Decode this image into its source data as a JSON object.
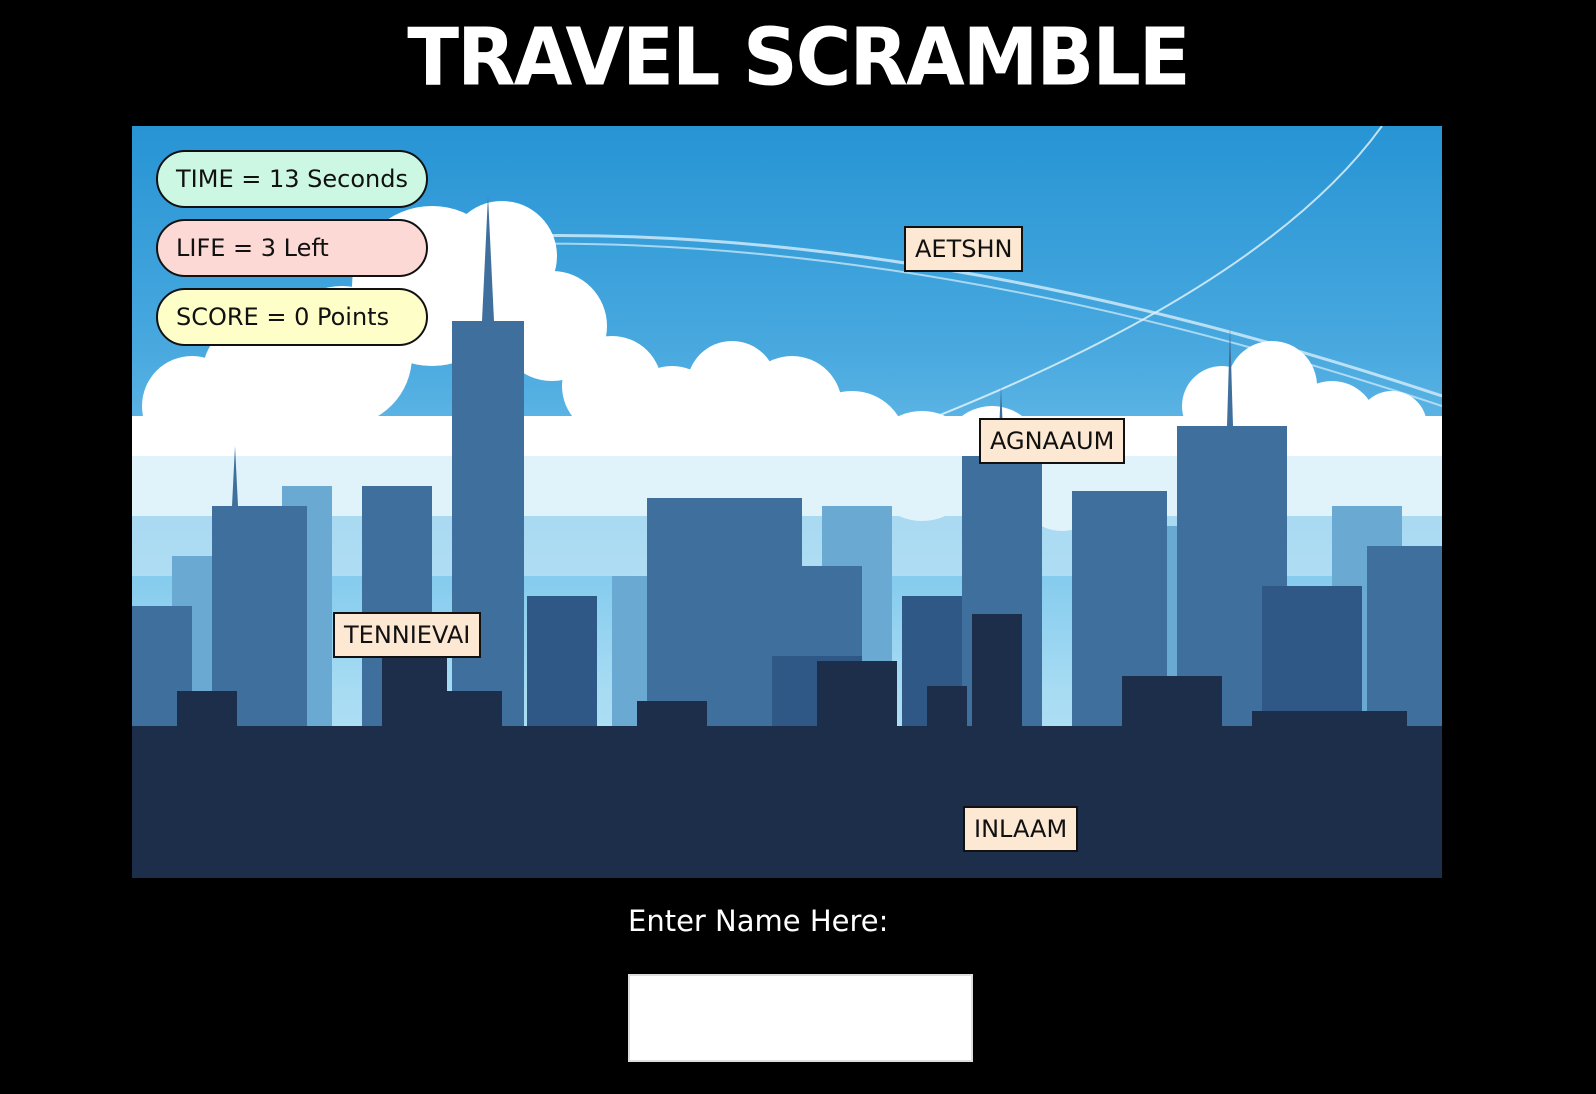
{
  "title": "TRAVEL SCRAMBLE",
  "hud": {
    "time": "TIME = 13 Seconds",
    "life": "LIFE = 3 Left",
    "score": "SCORE = 0 Points"
  },
  "scrambled_words": [
    "AETSHN",
    "AGNAAUM",
    "TENNIEVAI",
    "INLAAM"
  ],
  "name_prompt": {
    "label": "Enter Name Here:",
    "value": ""
  },
  "colors": {
    "background": "#000000",
    "time_pill": "#ccf8e3",
    "life_pill": "#fdd9d5",
    "score_pill": "#fefec9",
    "word_tile": "#fde8d3",
    "sky_top": "#2794d4",
    "skyline_dark": "#1c2e4a"
  }
}
